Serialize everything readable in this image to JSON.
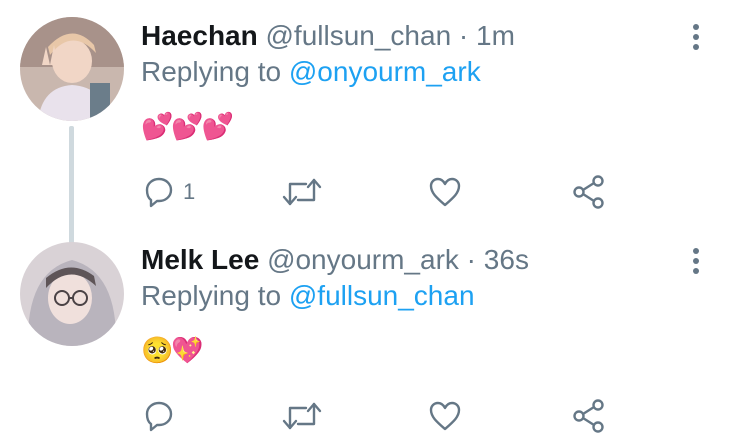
{
  "tweets": [
    {
      "name": "Haechan",
      "handle": "@fullsun_chan",
      "sep": " · ",
      "time": "1m",
      "replying_prefix": "Replying to ",
      "replying_to": "@onyourm_ark",
      "body": "💕💕💕",
      "reply_count": "1",
      "avatar_icon": "person-peace-sign-avatar"
    },
    {
      "name": "Melk Lee",
      "handle": "@onyourm_ark",
      "sep": " · ",
      "time": "36s",
      "replying_prefix": "Replying to ",
      "replying_to": "@fullsun_chan",
      "body": "🥺💖",
      "reply_count": "",
      "avatar_icon": "person-glasses-hoodie-avatar"
    }
  ],
  "colors": {
    "name": "#14171a",
    "meta": "#657786",
    "mention": "#1da1f2",
    "icon": "#657786",
    "thread_line": "#cfd9de"
  },
  "icons": [
    "reply-icon",
    "retweet-icon",
    "like-icon",
    "share-icon",
    "more-options-icon"
  ]
}
